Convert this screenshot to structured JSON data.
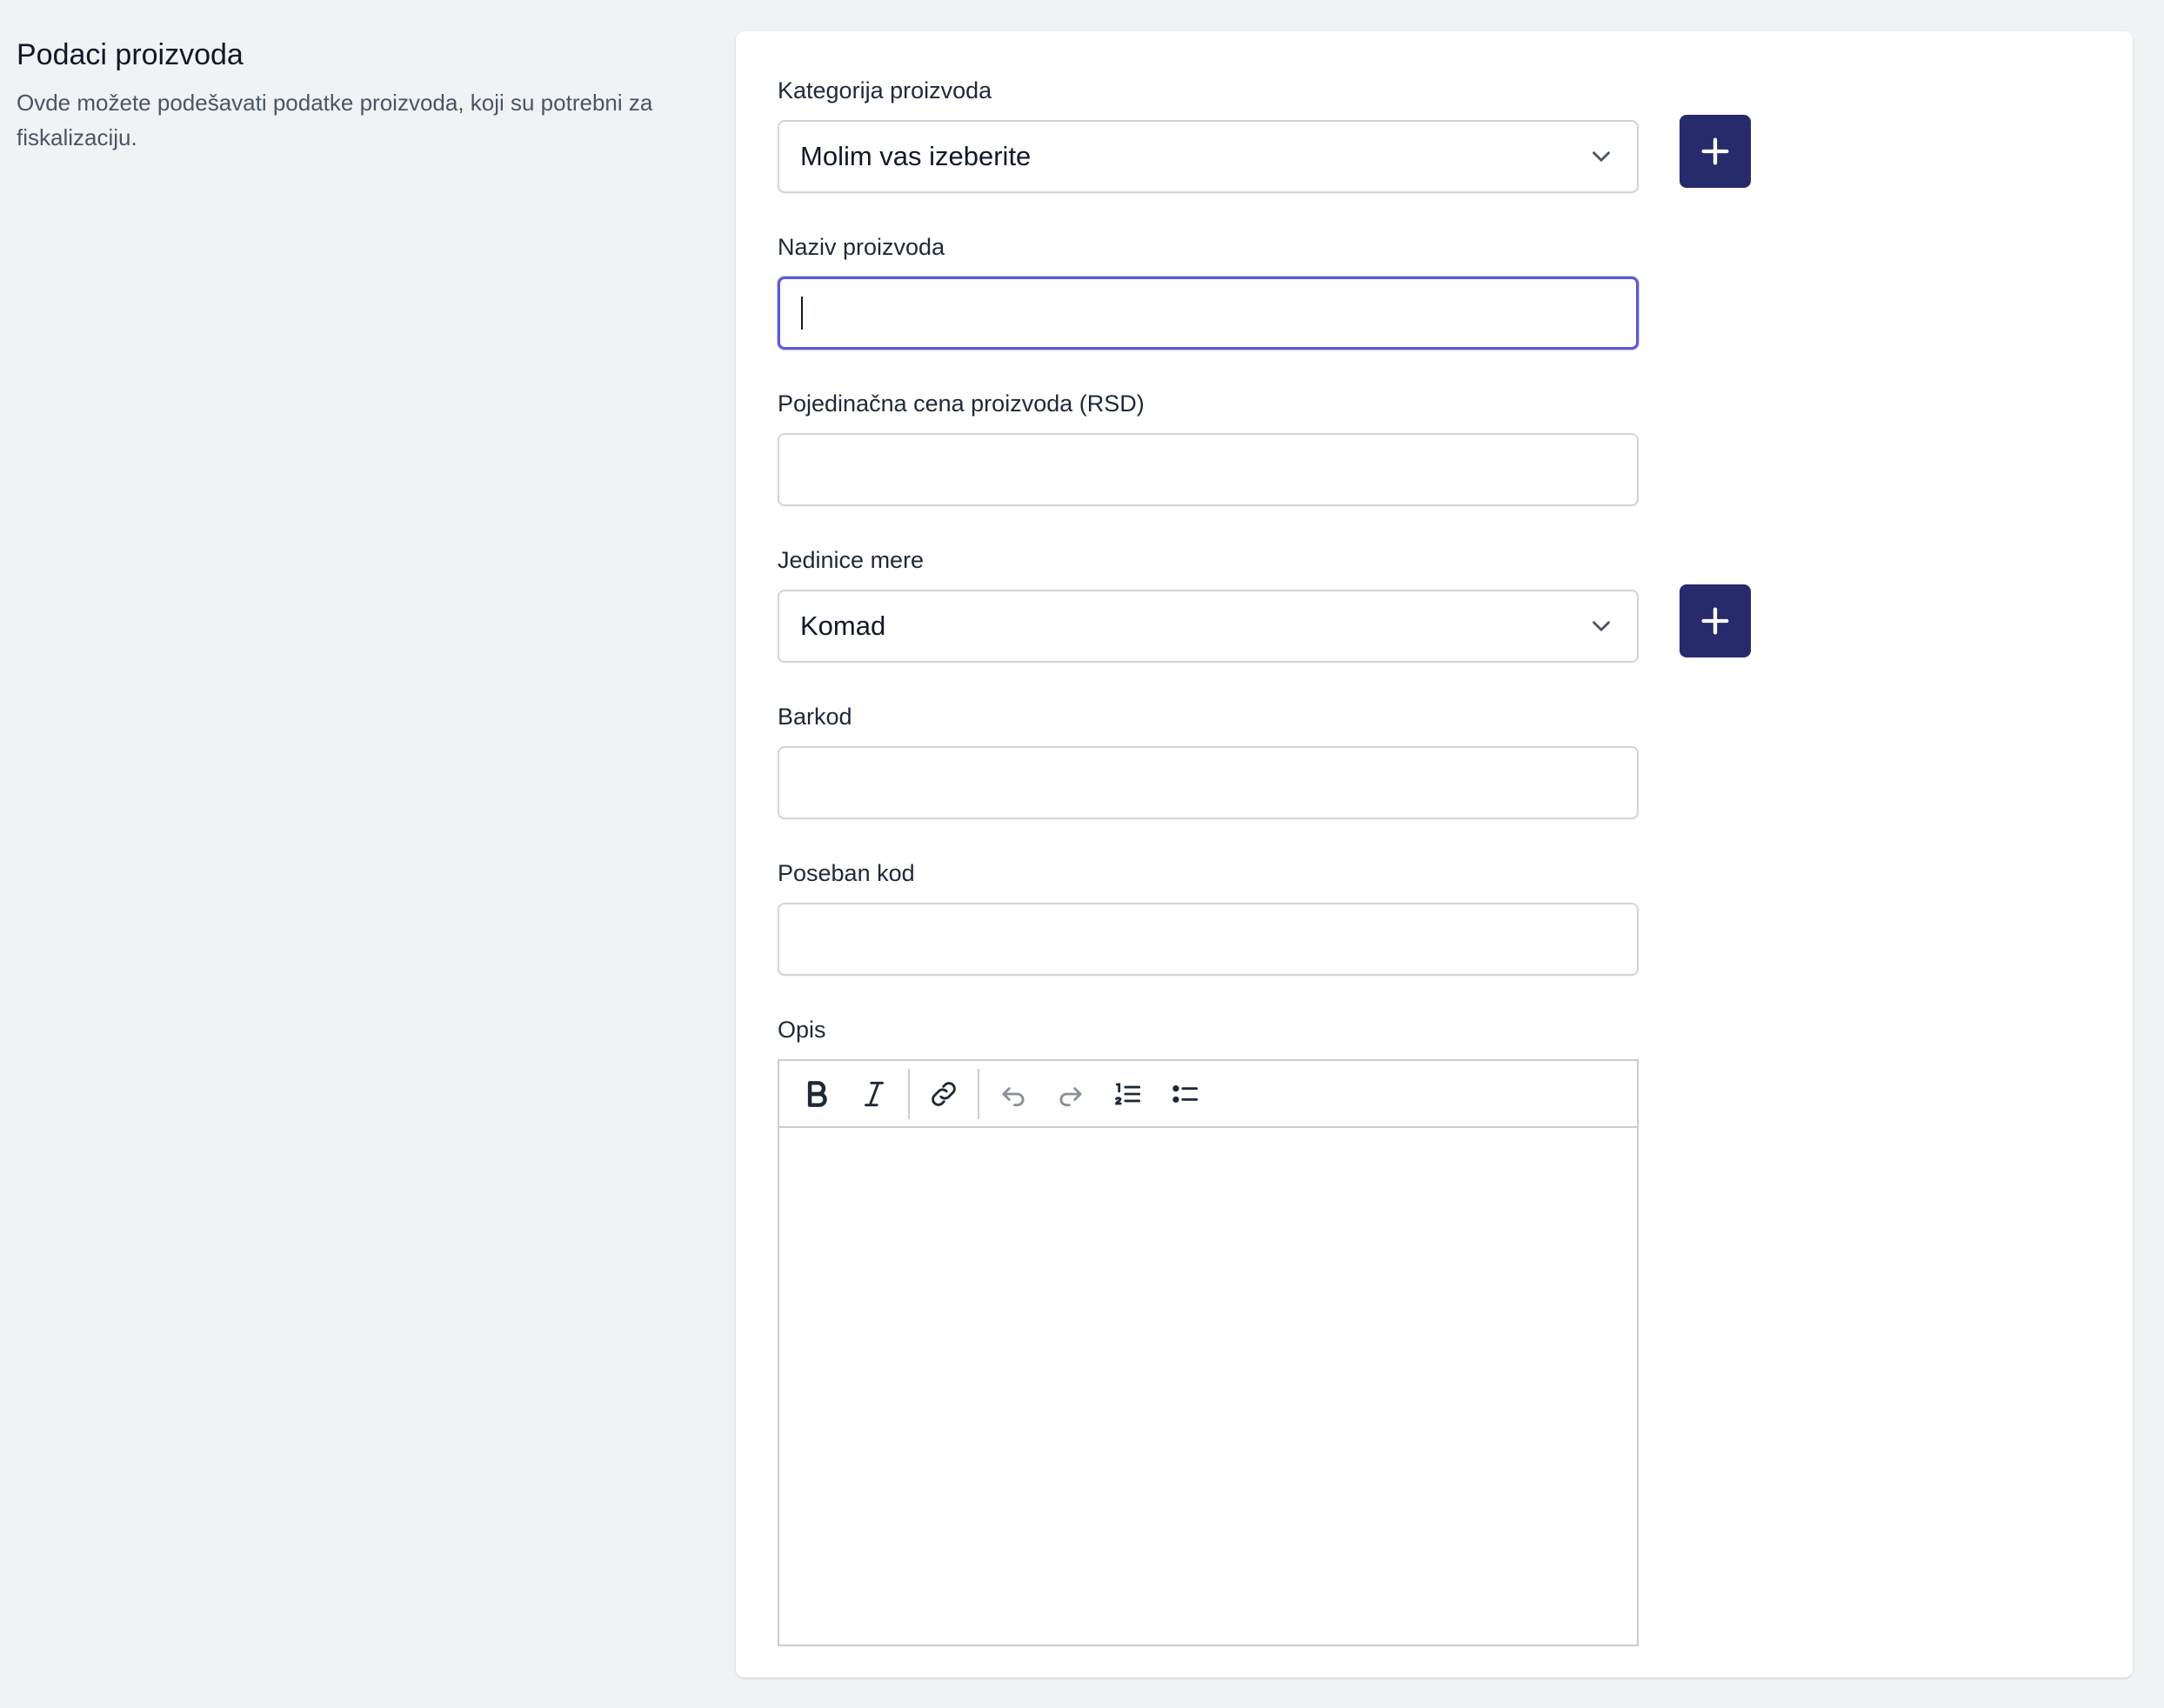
{
  "section": {
    "title": "Podaci proizvoda",
    "description": "Ovde možete podešavati podatke proizvoda, koji su potrebni za fiskalizaciju."
  },
  "form": {
    "category": {
      "label": "Kategorija proizvoda",
      "selected": "Molim vas izeberite"
    },
    "name": {
      "label": "Naziv proizvoda",
      "value": ""
    },
    "price": {
      "label": "Pojedinačna cena proizvoda (RSD)",
      "value": ""
    },
    "unit": {
      "label": "Jedinice mere",
      "selected": "Komad"
    },
    "barcode": {
      "label": "Barkod",
      "value": ""
    },
    "special_code": {
      "label": "Poseban kod",
      "value": ""
    },
    "description": {
      "label": "Opis",
      "value": ""
    }
  },
  "colors": {
    "accent_button": "#272a6b",
    "focus_ring": "#5b5bd6",
    "page_background": "#f1f2f4"
  },
  "icons": {
    "add": "plus-icon",
    "dropdown": "chevron-down-icon",
    "toolbar": [
      "bold-icon",
      "italic-icon",
      "link-icon",
      "undo-icon",
      "redo-icon",
      "numbered-list-icon",
      "bulleted-list-icon"
    ]
  }
}
